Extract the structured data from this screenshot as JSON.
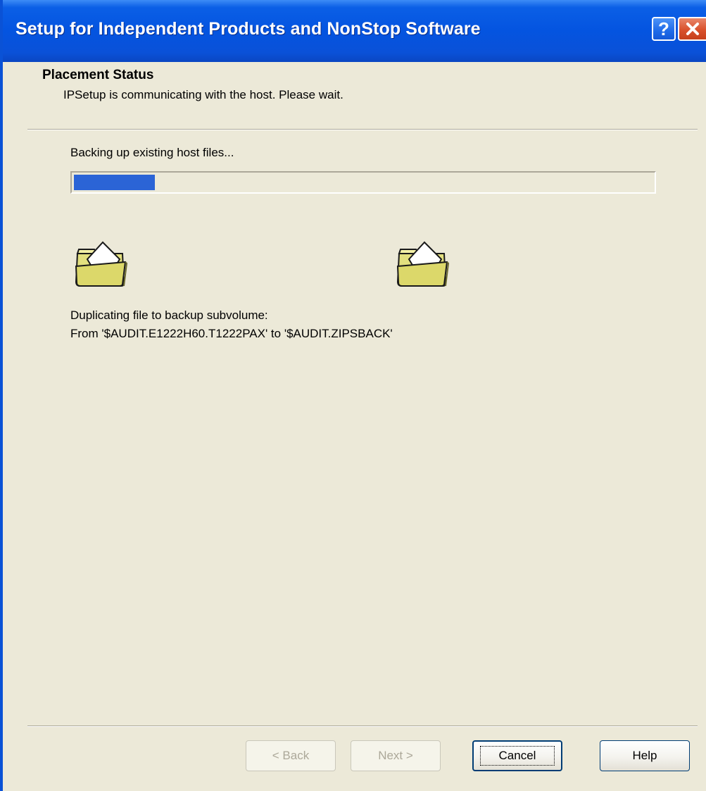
{
  "window": {
    "title": "Setup for Independent Products and NonStop Software",
    "help_glyph": "?"
  },
  "header": {
    "title": "Placement Status",
    "subtitle": "IPSetup is communicating with the host. Please wait."
  },
  "status": {
    "text": "Backing up existing host files...",
    "progress_percent": 14
  },
  "detail": {
    "line1": "Duplicating file to backup subvolume:",
    "line2": "From '$AUDIT.E1222H60.T1222PAX' to '$AUDIT.ZIPSBACK'"
  },
  "buttons": {
    "back": {
      "label": "< Back",
      "enabled": false
    },
    "next": {
      "label": "Next >",
      "enabled": false
    },
    "cancel": {
      "label": "Cancel",
      "enabled": true,
      "default": true
    },
    "help": {
      "label": "Help",
      "enabled": true
    }
  },
  "colors": {
    "title_bar": "#0454e0",
    "dialog_background": "#ece9d8",
    "progress_fill": "#2b64d6",
    "folder_yellow": "#e3e07f"
  },
  "icons": {
    "source_folder": "folder-icon",
    "destination_folder": "folder-icon",
    "help": "help-icon",
    "close": "close-icon"
  }
}
